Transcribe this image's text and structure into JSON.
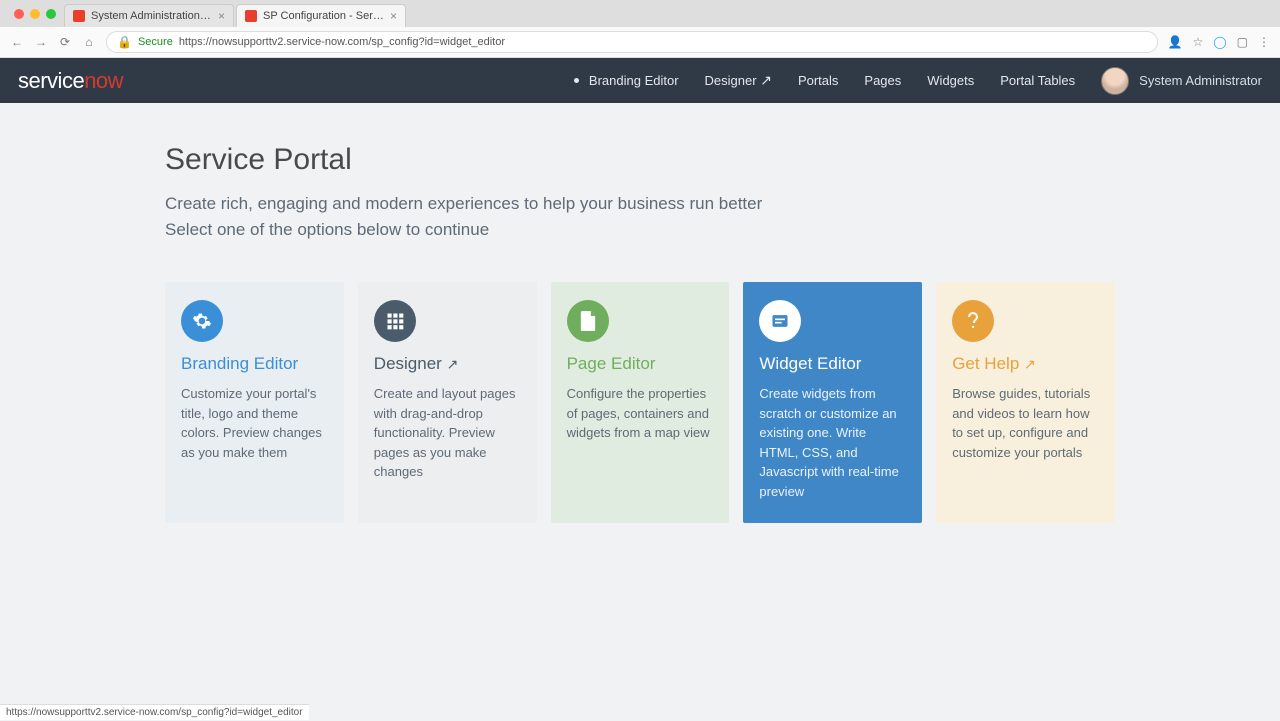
{
  "browser": {
    "tabs": [
      {
        "title": "System Administration | Servi..."
      },
      {
        "title": "SP Configuration - Service Po..."
      }
    ],
    "secure_label": "Secure",
    "url_display": "https://nowsupporttv2.service-now.com/sp_config?id=widget_editor",
    "status_url": "https://nowsupporttv2.service-now.com/sp_config?id=widget_editor"
  },
  "header": {
    "logo_service": "service",
    "logo_now": "now",
    "nav": [
      {
        "label": "Branding Editor",
        "active": true,
        "external": false
      },
      {
        "label": "Designer",
        "external": true
      },
      {
        "label": "Portals"
      },
      {
        "label": "Pages"
      },
      {
        "label": "Widgets"
      },
      {
        "label": "Portal Tables"
      }
    ],
    "user": "System Administrator"
  },
  "page": {
    "title": "Service Portal",
    "lead_line1": "Create rich, engaging and modern experiences to help your business run better",
    "lead_line2": "Select one of the options below to continue"
  },
  "cards": [
    {
      "title": "Branding Editor",
      "desc": "Customize your portal's title, logo and theme colors. Preview changes as you make them",
      "icon": "gear-icon",
      "external": false
    },
    {
      "title": "Designer",
      "desc": "Create and layout pages with drag-and-drop functionality. Preview pages as you make changes",
      "icon": "grid-icon",
      "external": true
    },
    {
      "title": "Page Editor",
      "desc": "Configure the properties of pages, containers and widgets from a map view",
      "icon": "page-icon",
      "external": false
    },
    {
      "title": "Widget Editor",
      "desc": "Create widgets from scratch or customize an existing one. Write HTML, CSS, and Javascript with real-time preview",
      "icon": "widget-icon",
      "external": false
    },
    {
      "title": "Get Help",
      "desc": "Browse guides, tutorials and videos to learn how to set up, configure and customize your portals",
      "icon": "help-icon",
      "external": true
    }
  ]
}
